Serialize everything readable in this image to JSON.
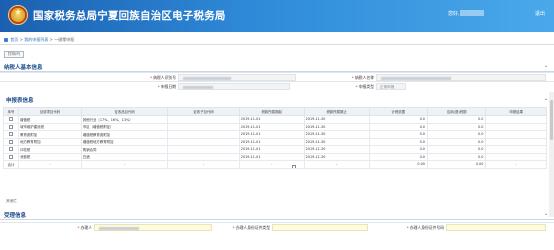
{
  "header": {
    "title": "国家税务总局宁夏回族自治区电子税务局",
    "user_label": "您好,",
    "logout_label": "退出"
  },
  "breadcrumb": {
    "home": "首页",
    "sep1": ">",
    "item1": "我的申报列表",
    "sep2": ">",
    "item2": "一键零申报"
  },
  "toolbar": {
    "print_label": "打印(P)"
  },
  "taxpayer_info": {
    "section_title": "纳税人基本信息",
    "taxpayer_id_label": "纳税人识别号",
    "taxpayer_name_label": "纳税人名称",
    "period_label": "申报日期",
    "type_label": "申报类型",
    "type_value": "正常申报"
  },
  "declaration": {
    "section_title": "申报表信息",
    "columns": [
      "序号",
      "征收项目代码",
      "征收品目代码",
      "征收子目代码",
      "税款所属期起",
      "税款所属期止",
      "计税依据",
      "应纳(退)税额",
      "申报结果"
    ],
    "rows": [
      {
        "item": "增值税",
        "subitem": "其他行业（17%、16%、13%）",
        "sub": "",
        "start": "2019-11-01",
        "end": "2019-11-30",
        "basis": "0.0",
        "tax": "0.0",
        "result": ""
      },
      {
        "item": "城市维护建设税",
        "subitem": "市区（增值税附征）",
        "sub": "",
        "start": "2019-11-01",
        "end": "2019-11-30",
        "basis": "0.0",
        "tax": "0.0",
        "result": ""
      },
      {
        "item": "教育费附加",
        "subitem": "增值税教育费附加",
        "sub": "",
        "start": "2019-11-01",
        "end": "2019-11-30",
        "basis": "0.0",
        "tax": "0.0",
        "result": ""
      },
      {
        "item": "地方教育附加",
        "subitem": "增值税地方教育附加",
        "sub": "",
        "start": "2019-11-01",
        "end": "2019-11-30",
        "basis": "0.0",
        "tax": "0.0",
        "result": ""
      },
      {
        "item": "印花税",
        "subitem": "购销合同",
        "sub": "",
        "start": "2019-11-01",
        "end": "2019-11-30",
        "basis": "0.0",
        "tax": "0.0",
        "result": ""
      },
      {
        "item": "消费税",
        "subitem": "白酒",
        "sub": "",
        "start": "2019-11-01",
        "end": "2019-11-30",
        "basis": "0.0",
        "tax": "0.0",
        "result": ""
      }
    ],
    "total": {
      "label": "合计",
      "dash": "-",
      "basis": "0.00",
      "tax": "0.00"
    },
    "note": "其他栏"
  },
  "acceptance": {
    "section_title": "受理信息",
    "handler_label": "办理人",
    "handler_id_type_label": "办理人身份证件类型",
    "handler_id_label": "办理人身份证件号码"
  }
}
